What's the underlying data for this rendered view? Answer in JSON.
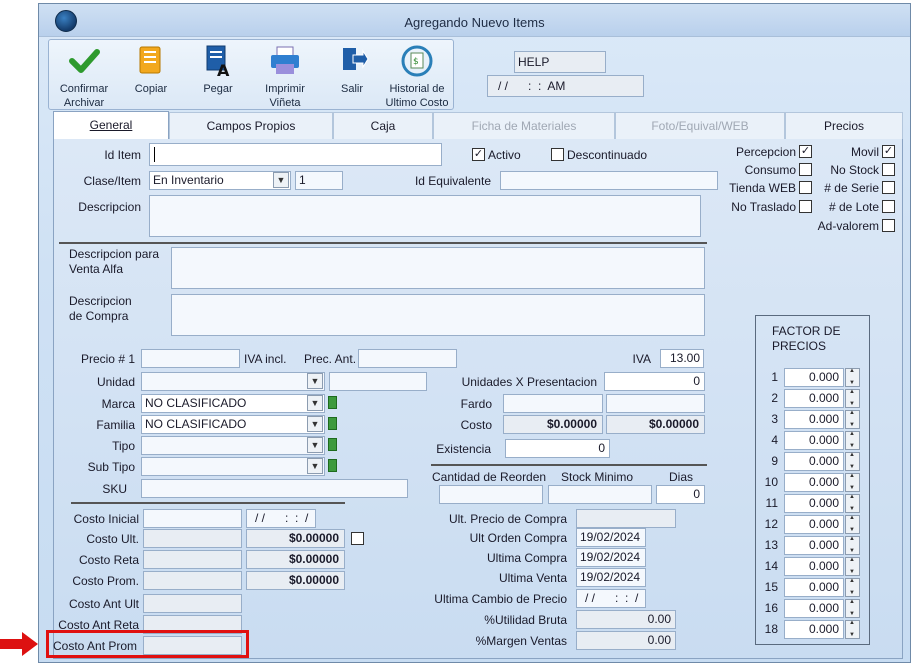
{
  "window": {
    "title": "Agregando Nuevo Items"
  },
  "toolbar": {
    "confirm": "Confirmar\nArchivar",
    "copy": "Copiar",
    "paste": "Pegar",
    "print": "Imprimir\nViñeta",
    "exit": "Salir",
    "history": "Historial de\nUltimo Costo"
  },
  "help": {
    "label": "HELP",
    "datetime": "/ /      :  :  AM"
  },
  "tabs": [
    {
      "label": "General"
    },
    {
      "label": "Campos Propios"
    },
    {
      "label": "Caja"
    },
    {
      "label": "Ficha de Materiales"
    },
    {
      "label": "Foto/Equival/WEB"
    },
    {
      "label": "Precios"
    }
  ],
  "form": {
    "id_item": "Id Item",
    "activo": "Activo",
    "descontinuado": "Descontinuado",
    "clase_item": "Clase/Item",
    "clase_value": "En Inventario",
    "clase_num": "1",
    "id_equivalente": "Id Equivalente",
    "descripcion": "Descripcion",
    "desc_venta": "Descripcion para\nVenta Alfa",
    "desc_compra": "Descripcion\nde Compra",
    "precio1": "Precio # 1",
    "iva_incl": "IVA incl.",
    "prec_ant": "Prec. Ant.",
    "iva": "IVA",
    "iva_value": "13.00",
    "unidad": "Unidad",
    "unidades_pres": "Unidades X Presentacion",
    "unidades_value": "0",
    "marca": "Marca",
    "marca_value": "NO CLASIFICADO",
    "fardo": "Fardo",
    "familia": "Familia",
    "familia_value": "NO CLASIFICADO",
    "costo": "Costo",
    "costo_value1": "$0.00000",
    "costo_value2": "$0.00000",
    "tipo": "Tipo",
    "existencia": "Existencia",
    "existencia_value": "0",
    "sub_tipo": "Sub Tipo",
    "sku": "SKU",
    "cant_reorden": "Cantidad de Reorden",
    "stock_min": "Stock Minimo",
    "dias": "Dias",
    "dias_value": "0"
  },
  "flags": {
    "percepcion": "Percepcion",
    "movil": "Movil",
    "consumo": "Consumo",
    "no_stock": "No Stock",
    "tienda_web": "Tienda WEB",
    "num_serie": "# de Serie",
    "no_traslado": "No Traslado",
    "num_lote": "# de Lote",
    "ad_valorem": "Ad-valorem"
  },
  "costos": {
    "costo_inicial": "Costo Inicial",
    "costo_inicial_date": "/ /      :  :  /",
    "costo_ult": "Costo Ult.",
    "costo_ult_value": "$0.00000",
    "costo_reta": "Costo Reta",
    "costo_reta_value": "$0.00000",
    "costo_prom": "Costo Prom.",
    "costo_prom_value": "$0.00000",
    "costo_ant_ult": "Costo Ant Ult",
    "costo_ant_reta": "Costo Ant Reta",
    "costo_ant_prom": "Costo Ant Prom"
  },
  "compras": {
    "ult_precio": "Ult. Precio de Compra",
    "ult_orden": "Ult Orden Compra",
    "ult_orden_value": "19/02/2024",
    "ultima_compra": "Ultima Compra",
    "ultima_compra_value": "19/02/2024",
    "ultima_venta": "Ultima Venta",
    "ultima_venta_value": "19/02/2024",
    "ultima_cambio": "Ultima Cambio de Precio",
    "ultima_cambio_value": "/ /      :  :  /",
    "utilidad": "%Utilidad Bruta",
    "utilidad_value": "0.00",
    "margen": "%Margen Ventas",
    "margen_value": "0.00"
  },
  "factor": {
    "title": "FACTOR DE\nPRECIOS",
    "rows": [
      {
        "n": "1",
        "v": "0.000"
      },
      {
        "n": "2",
        "v": "0.000"
      },
      {
        "n": "3",
        "v": "0.000"
      },
      {
        "n": "4",
        "v": "0.000"
      },
      {
        "n": "9",
        "v": "0.000"
      },
      {
        "n": "10",
        "v": "0.000"
      },
      {
        "n": "11",
        "v": "0.000"
      },
      {
        "n": "12",
        "v": "0.000"
      },
      {
        "n": "13",
        "v": "0.000"
      },
      {
        "n": "14",
        "v": "0.000"
      },
      {
        "n": "15",
        "v": "0.000"
      },
      {
        "n": "16",
        "v": "0.000"
      },
      {
        "n": "18",
        "v": "0.000"
      }
    ]
  },
  "colors": {
    "highlight": "#e01010",
    "arrow": "#dd1111"
  }
}
